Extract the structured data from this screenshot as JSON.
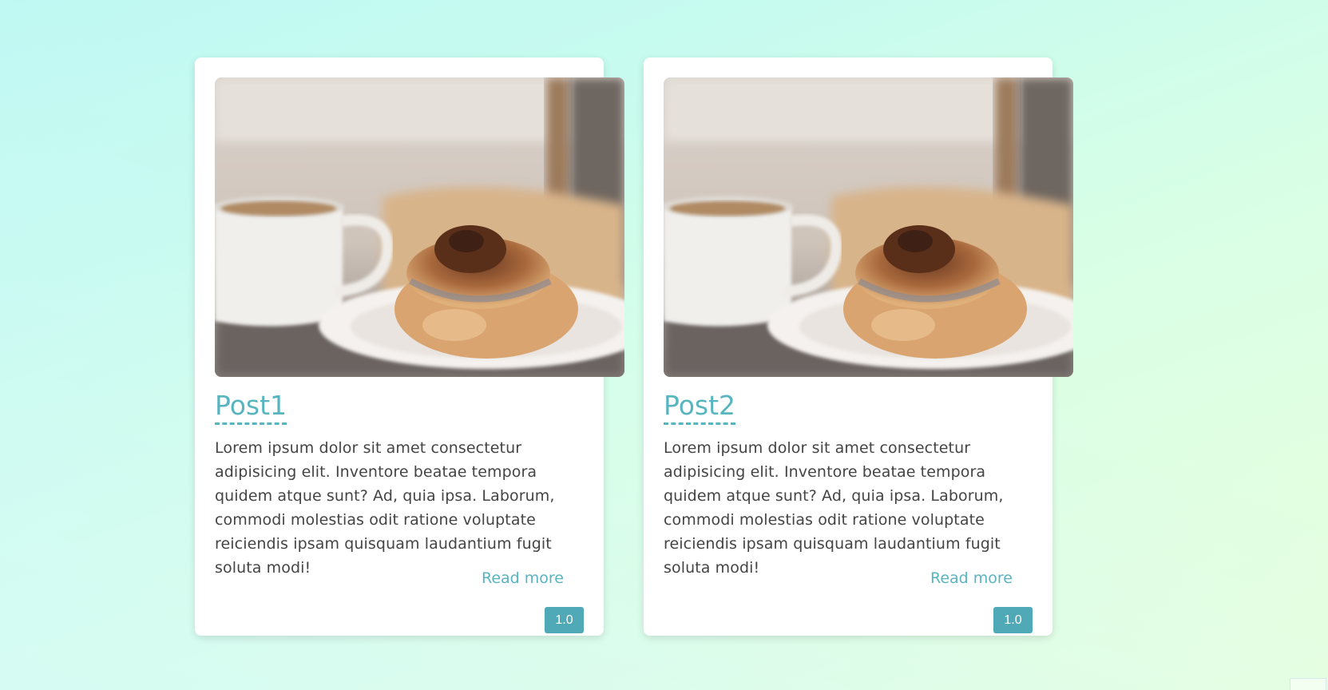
{
  "posts": [
    {
      "title": "Post1",
      "body": "Lorem ipsum dolor sit amet consectetur adipisicing elit. Inventore beatae tempora quidem atque sunt? Ad, quia ipsa. Laborum, commodi molestias odit ratione voluptate reiciendis ipsam quisquam laudantium fugit soluta modi!",
      "read_more": "Read more",
      "badge": "1.0",
      "image_name": "coffee-cinnamon-roll-photo"
    },
    {
      "title": "Post2",
      "body": "Lorem ipsum dolor sit amet consectetur adipisicing elit. Inventore beatae tempora quidem atque sunt? Ad, quia ipsa. Laborum, commodi molestias odit ratione voluptate reiciendis ipsam quisquam laudantium fugit soluta modi!",
      "read_more": "Read more",
      "badge": "1.0",
      "image_name": "coffee-cinnamon-roll-photo"
    }
  ],
  "colors": {
    "accent": "#58b5bf",
    "badge_bg": "#4fa9b6",
    "body_text": "#444444",
    "card_bg": "#ffffff"
  }
}
